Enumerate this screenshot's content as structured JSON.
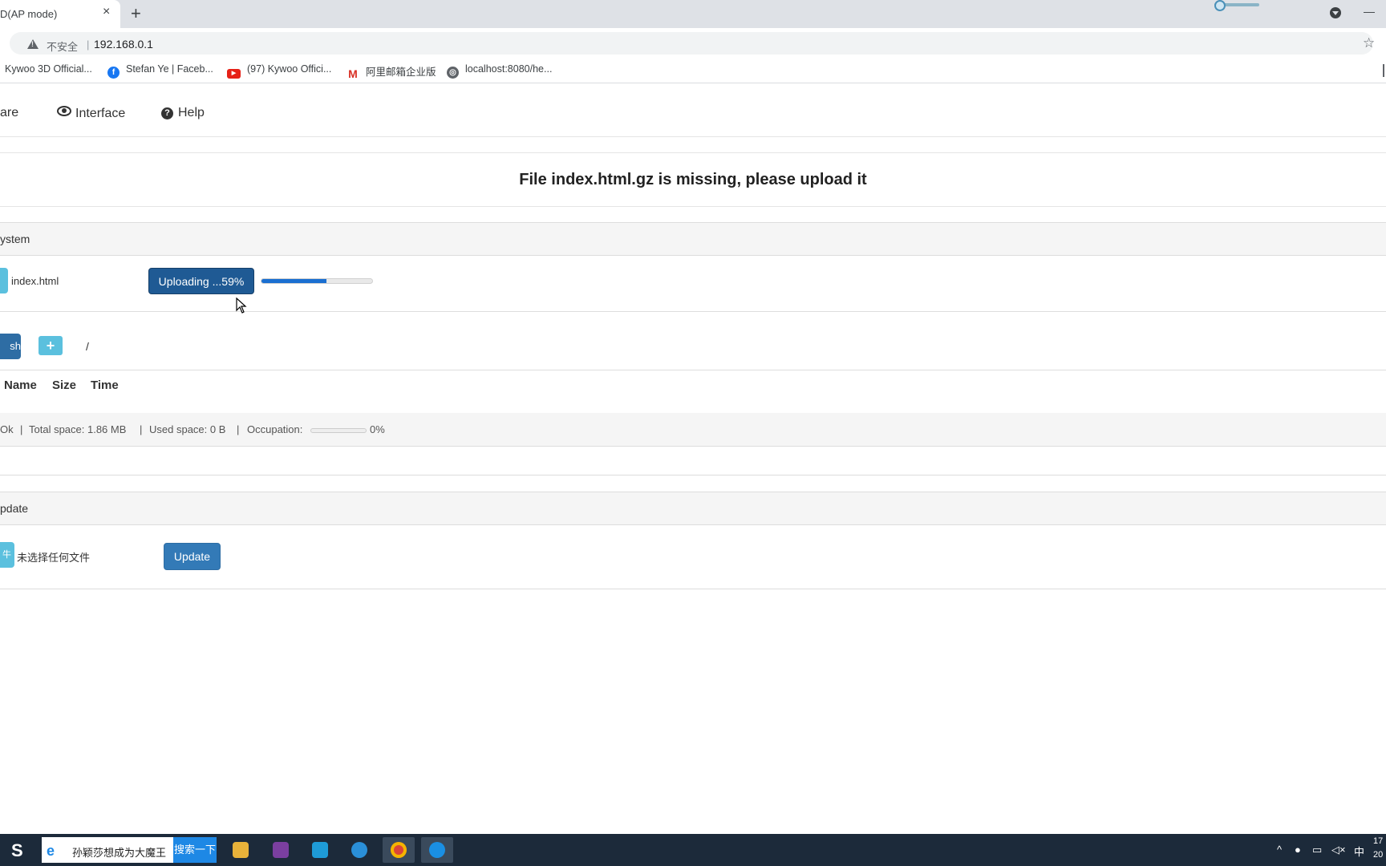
{
  "browser": {
    "tab_title": "D(AP mode)",
    "tab_close": "×",
    "new_tab": "+",
    "minimize": "—",
    "insecure_label": "不安全",
    "separator": "|",
    "url": "192.168.0.1",
    "star": "☆",
    "bookmarks": [
      {
        "label": "Kywoo 3D Official...",
        "icon": "none"
      },
      {
        "label": "Stefan Ye | Faceb...",
        "icon": "facebook-icon"
      },
      {
        "label": "(97) Kywoo Offici...",
        "icon": "youtube-icon"
      },
      {
        "label": "阿里邮箱企业版",
        "icon": "mail-icon"
      },
      {
        "label": "localhost:8080/he...",
        "icon": "globe-icon"
      }
    ]
  },
  "nav": {
    "items": [
      {
        "label": "are"
      },
      {
        "label": "Interface",
        "icon": "eye-icon"
      },
      {
        "label": "Help",
        "icon": "question-circle-icon"
      }
    ]
  },
  "banner": {
    "message": "File index.html.gz is missing, please upload it"
  },
  "filesystem": {
    "header": "ystem",
    "upload": {
      "file_name": "index.html",
      "button_label": "Uploading ...59%",
      "progress_percent": 59
    },
    "refresh_label": "sh",
    "add_label": "+",
    "path": "/",
    "columns": [
      "Name",
      "Size",
      "Time"
    ],
    "status": {
      "ok": "Ok",
      "sep": "|",
      "total_space": "Total space: 1.86 MB",
      "used_space": "Used space: 0 B",
      "occupation_label": "Occupation:",
      "occupation_value": "0%",
      "occupation_percent": 0
    }
  },
  "update": {
    "header": "pdate",
    "choose_stub": "牛",
    "no_file": "未选择任何文件",
    "button_label": "Update"
  },
  "taskbar": {
    "search_query": "孙颖莎想成为大魔王",
    "search_button": "搜索一下",
    "tray_ime": "中",
    "tray_time": "17",
    "tray_date": "20",
    "apps": [
      "file-explorer-icon",
      "app-icon",
      "c-icon",
      "q-icon",
      "chrome-icon",
      "feiyu-icon"
    ]
  },
  "colors": {
    "primary": "#337ab7",
    "uploading": "#1f5a94",
    "info": "#5bc0de",
    "progress": "#1a6fd1"
  }
}
